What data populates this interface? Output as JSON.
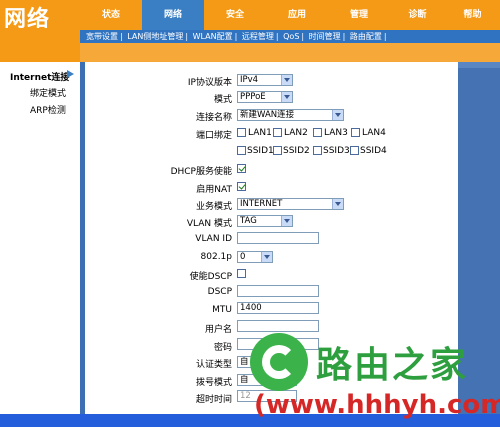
{
  "logo": "网络",
  "nav": [
    {
      "label": "状态",
      "active": false
    },
    {
      "label": "网络",
      "active": true
    },
    {
      "label": "安全",
      "active": false
    },
    {
      "label": "应用",
      "active": false
    },
    {
      "label": "管理",
      "active": false
    },
    {
      "label": "诊断",
      "active": false
    },
    {
      "label": "帮助",
      "active": false
    }
  ],
  "subnav": [
    "宽带设置",
    "|",
    "LAN侧地址管理",
    "|",
    "WLAN配置",
    "|",
    "远程管理",
    "|",
    "QoS",
    "|",
    "时间管理",
    "|",
    "路由配置",
    "|"
  ],
  "sidebar": {
    "title": "Internet连接",
    "items": [
      "绑定模式",
      "ARP检测"
    ]
  },
  "form": {
    "ip_version": {
      "label": "IP协议版本",
      "value": "IPv4"
    },
    "mode": {
      "label": "模式",
      "value": "PPPoE"
    },
    "conn_name": {
      "label": "连接名称",
      "value": "新建WAN连接"
    },
    "port_bind": {
      "label": "端口绑定",
      "ports": [
        "LAN1",
        "LAN2",
        "LAN3",
        "LAN4",
        "SSID1",
        "SSID2",
        "SSID3",
        "SSID4"
      ]
    },
    "dhcp": {
      "label": "DHCP服务使能",
      "checked": true
    },
    "nat": {
      "label": "启用NAT",
      "checked": true
    },
    "service_mode": {
      "label": "业务模式",
      "value": "INTERNET"
    },
    "vlan_mode": {
      "label": "VLAN 模式",
      "value": "TAG"
    },
    "vlan_id": {
      "label": "VLAN ID",
      "value": ""
    },
    "p8021": {
      "label": "802.1p",
      "value": "0"
    },
    "dscp_enable": {
      "label": "使能DSCP",
      "checked": false
    },
    "dscp": {
      "label": "DSCP",
      "value": ""
    },
    "mtu": {
      "label": "MTU",
      "value": "1400"
    },
    "username": {
      "label": "用户名",
      "value": ""
    },
    "password": {
      "label": "密码",
      "value": ""
    },
    "auth_type": {
      "label": "认证类型",
      "value": "自"
    },
    "dial_mode": {
      "label": "拨号模式",
      "value": "自"
    },
    "timeout": {
      "label": "超时时间",
      "value": "12"
    }
  },
  "watermark": {
    "text": "路由之家",
    "url": "(www.hhhyh.com)"
  }
}
